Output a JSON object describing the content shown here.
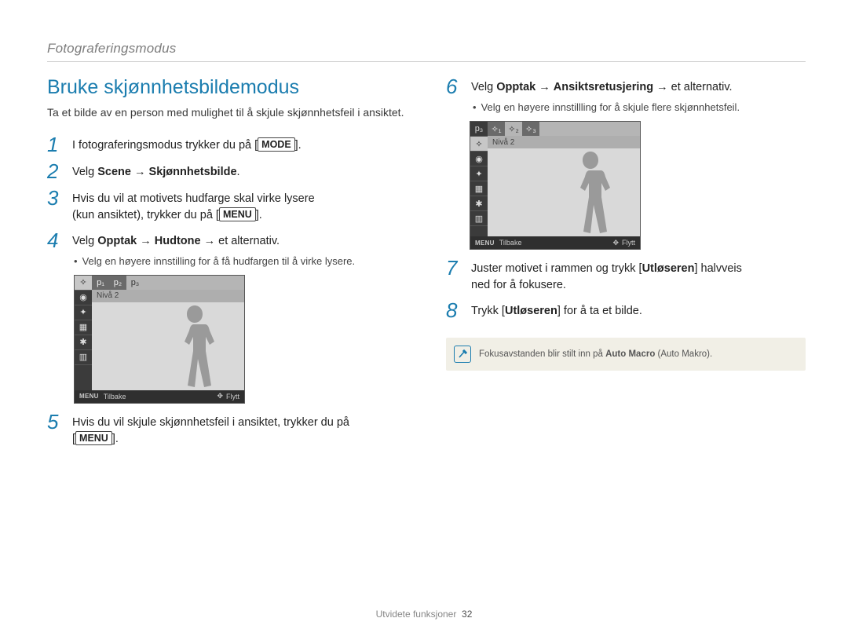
{
  "section_header": "Fotograferingsmodus",
  "left": {
    "title": "Bruke skjønnhetsbildemodus",
    "intro": "Ta et bilde av en person med mulighet til å skjule skjønnhetsfeil i ansiktet.",
    "step1_pre": "I fotograferingsmodus trykker du på [",
    "step1_btn": "MODE",
    "step1_post": "].",
    "step2_pre": "Velg ",
    "step2_b1": "Scene",
    "step2_arrow": " → ",
    "step2_b2": "Skjønnhetsbilde",
    "step2_post": ".",
    "step3_line1": "Hvis du vil at motivets hudfarge skal virke lysere",
    "step3_line2_pre": "(kun ansiktet), trykker du på [",
    "step3_btn": "MENU",
    "step3_line2_post": "].",
    "step4_pre": "Velg ",
    "step4_b1": "Opptak",
    "step4_arrow1": " → ",
    "step4_b2": "Hudtone",
    "step4_arrow2": " → ",
    "step4_tail": "et alternativ.",
    "step4_sub": "Velg en høyere innstilling for å få hudfargen til å virke lysere.",
    "fig1": {
      "level": "Nivå 2",
      "menu": "MENU",
      "back": "Tilbake",
      "move": "Flytt",
      "tabs": [
        "p1",
        "p2",
        "p3"
      ],
      "top_tab_mode": "face-tone"
    },
    "step5_pre": "Hvis du vil skjule skjønnhetsfeil i ansiktet, trykker du på",
    "step5_line2_pre": "[",
    "step5_btn": "MENU",
    "step5_line2_post": "]."
  },
  "right": {
    "step6_pre": "Velg ",
    "step6_b1": "Opptak",
    "step6_arrow1": " → ",
    "step6_b2": "Ansiktsretusjering",
    "step6_arrow2": " → ",
    "step6_tail": "et alternativ.",
    "step6_sub": "Velg en høyere innstillling for å skjule flere skjønnhetsfeil.",
    "fig2": {
      "level": "Nivå 2",
      "menu": "MENU",
      "back": "Tilbake",
      "move": "Flytt",
      "top_tab_mode": "face-retouch"
    },
    "step7_pre": "Juster motivet i rammen og trykk [",
    "step7_b": "Utløseren",
    "step7_mid": "] halvveis",
    "step7_line2": "ned for å fokusere.",
    "step8_pre": "Trykk [",
    "step8_b": "Utløseren",
    "step8_post": "] for å ta et bilde.",
    "note_pre": "Fokusavstanden blir stilt inn på ",
    "note_b": "Auto Macro",
    "note_paren": " (Auto Makro)."
  },
  "footer": {
    "section": "Utvidete funksjoner",
    "page": "32"
  }
}
